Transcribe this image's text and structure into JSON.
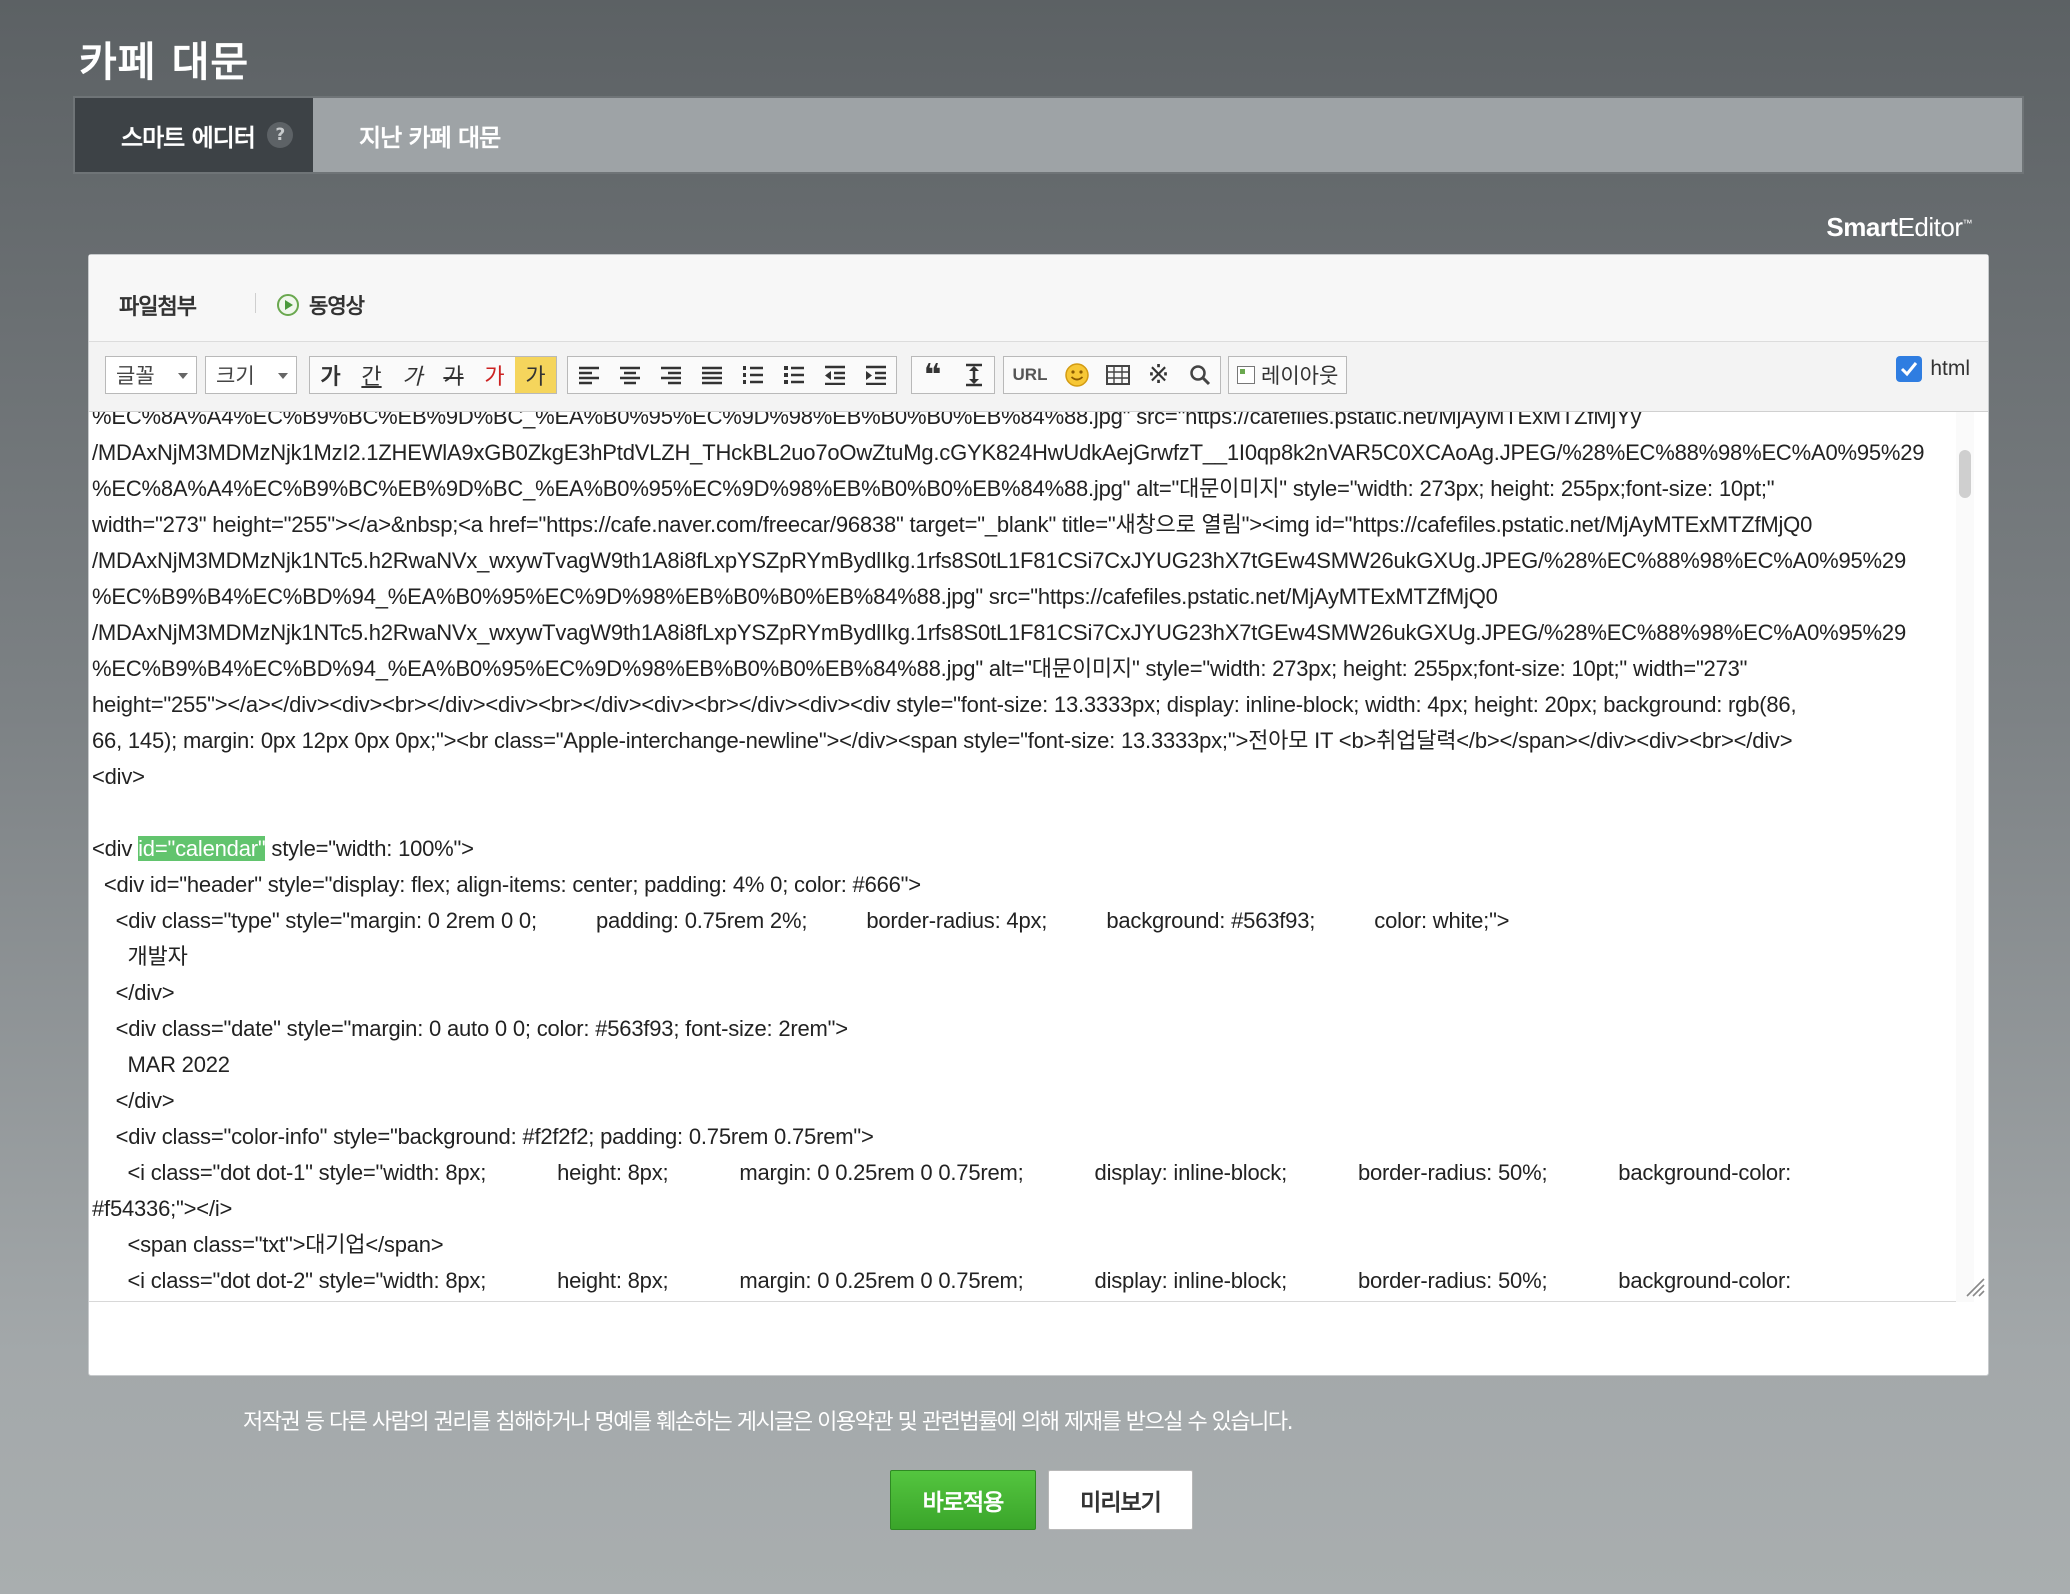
{
  "page": {
    "title": "카페 대문"
  },
  "tabs": [
    {
      "label": "스마트 에디터",
      "active": true,
      "help": "?"
    },
    {
      "label": "지난 카페 대문",
      "active": false
    }
  ],
  "editor": {
    "brand": {
      "bold": "Smart",
      "rest": "Editor",
      "mark": "™"
    },
    "attach": {
      "file": "파일첨부",
      "video": "동영상"
    },
    "toolbar": {
      "font_select": "글꼴",
      "size_select": "크기",
      "text_buttons": [
        "가",
        "간",
        "가",
        "가",
        "가",
        "가"
      ],
      "url_label": "URL",
      "layout_label": "레이아웃",
      "html_label": "html",
      "html_checked": true
    },
    "code_lines": [
      {
        "text": "%EC%8A%A4%EC%B9%BC%EB%9D%BC_%EA%B0%95%EC%9D%98%EB%B0%B0%EB%84%88.jpg\" src=\"https://cafefiles.pstatic.net/MjAyMTExMTZfMjYy"
      },
      {
        "text": "/MDAxNjM3MDMzNjk1MzI2.1ZHEWlA9xGB0ZkgE3hPtdVLZH_THckBL2uo7oOwZtuMg.cGYK824HwUdkAejGrwfzT__1I0qp8k2nVAR5C0XCAoAg.JPEG/%28%EC%88%98%EC%A0%95%29"
      },
      {
        "text": "%EC%8A%A4%EC%B9%BC%EB%9D%BC_%EA%B0%95%EC%9D%98%EB%B0%B0%EB%84%88.jpg\" alt=\"대문이미지\" style=\"width: 273px; height: 255px;font-size: 10pt;\""
      },
      {
        "text": "width=\"273\" height=\"255\"></a>&nbsp;<a href=\"https://cafe.naver.com/freecar/96838\" target=\"_blank\" title=\"새창으로 열림\"><img id=\"https://cafefiles.pstatic.net/MjAyMTExMTZfMjQ0"
      },
      {
        "text": "/MDAxNjM3MDMzNjk1NTc5.h2RwaNVx_wxywTvagW9th1A8i8fLxpYSZpRYmBydlIkg.1rfs8S0tL1F81CSi7CxJYUG23hX7tGEw4SMW26ukGXUg.JPEG/%28%EC%88%98%EC%A0%95%29"
      },
      {
        "text": "%EC%B9%B4%EC%BD%94_%EA%B0%95%EC%9D%98%EB%B0%B0%EB%84%88.jpg\" src=\"https://cafefiles.pstatic.net/MjAyMTExMTZfMjQ0"
      },
      {
        "text": "/MDAxNjM3MDMzNjk1NTc5.h2RwaNVx_wxywTvagW9th1A8i8fLxpYSZpRYmBydlIkg.1rfs8S0tL1F81CSi7CxJYUG23hX7tGEw4SMW26ukGXUg.JPEG/%28%EC%88%98%EC%A0%95%29"
      },
      {
        "text": "%EC%B9%B4%EC%BD%94_%EA%B0%95%EC%9D%98%EB%B0%B0%EB%84%88.jpg\" alt=\"대문이미지\" style=\"width: 273px; height: 255px;font-size: 10pt;\" width=\"273\""
      },
      {
        "text": "height=\"255\"></a></div><div><br></div><div><br></div><div><br></div><div><div style=\"font-size: 13.3333px; display: inline-block; width: 4px; height: 20px; background: rgb(86,"
      },
      {
        "text": "66, 145); margin: 0px 12px 0px 0px;\"><br class=\"Apple-interchange-newline\"></div><span style=\"font-size: 13.3333px;\">전아모 IT <b>취업달력</b></span></div><div><br></div>"
      },
      {
        "text": "<div>"
      },
      {
        "text": ""
      },
      {
        "pre": "<div ",
        "highlight": "id=\"calendar\"",
        "post": " style=\"width: 100%\">"
      },
      {
        "text": "  <div id=\"header\" style=\"display: flex; align-items: center; padding: 4% 0; color: #666\">"
      },
      {
        "text": "    <div class=\"type\" style=\"margin: 0 2rem 0 0;          padding: 0.75rem 2%;          border-radius: 4px;          background: #563f93;          color: white;\">"
      },
      {
        "text": "      개발자"
      },
      {
        "text": "    </div>"
      },
      {
        "text": "    <div class=\"date\" style=\"margin: 0 auto 0 0; color: #563f93; font-size: 2rem\">"
      },
      {
        "text": "      MAR 2022"
      },
      {
        "text": "    </div>"
      },
      {
        "text": "    <div class=\"color-info\" style=\"background: #f2f2f2; padding: 0.75rem 0.75rem\">"
      },
      {
        "text": "      <i class=\"dot dot-1\" style=\"width: 8px;            height: 8px;            margin: 0 0.25rem 0 0.75rem;            display: inline-block;            border-radius: 50%;            background-color:"
      },
      {
        "text": "#f54336;\"></i>"
      },
      {
        "text": "      <span class=\"txt\">대기업</span>"
      },
      {
        "text": "      <i class=\"dot dot-2\" style=\"width: 8px;            height: 8px;            margin: 0 0.25rem 0 0.75rem;            display: inline-block;            border-radius: 50%;            background-color:"
      }
    ]
  },
  "footer": {
    "notice": "저작권 등 다른 사람의 권리를 침해하거나 명예를 훼손하는 게시글은 이용약관 및 관련법률에 의해 제재를 받으실 수 있습니다.",
    "apply_label": "바로적용",
    "preview_label": "미리보기"
  },
  "colors": {
    "active_tab": "#3d4246",
    "apply_green": "#3aa52a",
    "highlight": "#62c46e",
    "checkbox": "#2f7de1"
  }
}
